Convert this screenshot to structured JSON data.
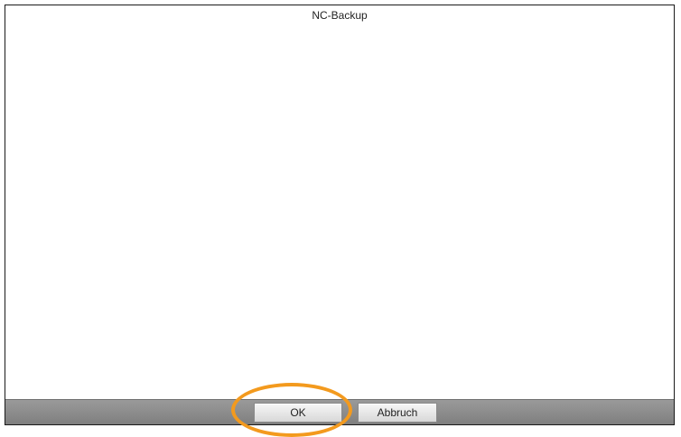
{
  "window": {
    "title": "NC-Backup"
  },
  "footer": {
    "ok_label": "OK",
    "cancel_label": "Abbruch"
  },
  "annotation": {
    "highlight_color": "#f39a1e"
  }
}
